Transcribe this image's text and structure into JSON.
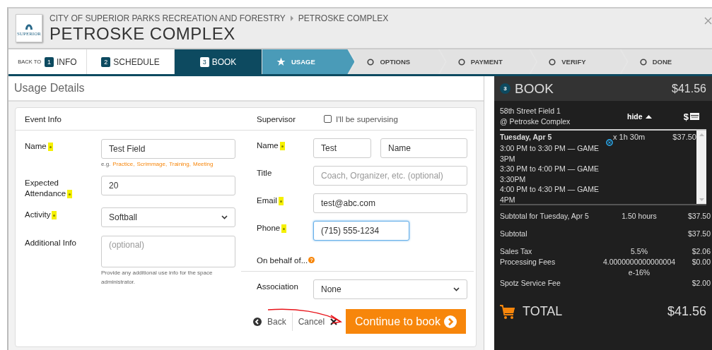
{
  "header": {
    "breadcrumb": [
      "CITY OF SUPERIOR PARKS RECREATION AND FORESTRY",
      "PETROSKE COMPLEX"
    ],
    "title": "PETROSKE COMPLEX",
    "logo_text": "SUPERIOR"
  },
  "steps": [
    {
      "kind": "back",
      "prefix": "BACK TO",
      "number": "1",
      "label": "INFO",
      "selected": false
    },
    {
      "kind": "numbered",
      "number": "2",
      "label": "SCHEDULE",
      "selected": false
    },
    {
      "kind": "numbered",
      "number": "3",
      "label": "BOOK",
      "selected": true
    }
  ],
  "substeps": [
    {
      "label": "USAGE",
      "selected": true
    },
    {
      "label": "OPTIONS",
      "selected": false
    },
    {
      "label": "PAYMENT",
      "selected": false
    },
    {
      "label": "VERIFY",
      "selected": false
    },
    {
      "label": "DONE",
      "selected": false
    }
  ],
  "section_title": "Usage Details",
  "event_info": {
    "heading": "Event Info",
    "fields": [
      {
        "kind": "text",
        "label": "Name",
        "required": true,
        "value": "Test Field",
        "examples_prefix": "e.g.",
        "examples": [
          "Practice,",
          "Scrimmage,",
          "Training,",
          "Meeting"
        ]
      },
      {
        "kind": "text",
        "label": "Expected Attendance",
        "required": true,
        "value": "20"
      },
      {
        "kind": "select",
        "label": "Activity",
        "required": true,
        "value": "Softball"
      },
      {
        "kind": "textarea",
        "label": "Additional Info",
        "required": false,
        "placeholder": "(optional)",
        "help": "Provide any additional use info for the space administrator."
      }
    ]
  },
  "supervisor": {
    "heading": "Supervisor",
    "self_checkbox": {
      "label": "I'll be supervising",
      "checked": false
    },
    "fields": [
      {
        "kind": "name",
        "label": "Name",
        "required": true,
        "first": "Test",
        "last": "Name"
      },
      {
        "kind": "text",
        "label": "Title",
        "required": false,
        "placeholder": "Coach, Organizer, etc. (optional)"
      },
      {
        "kind": "text",
        "label": "Email",
        "required": true,
        "value": "test@abc.com"
      },
      {
        "kind": "phone",
        "label": "Phone",
        "required": true,
        "value": "(715) 555-1234",
        "focused": true
      }
    ],
    "on_behalf": "On behalf of...",
    "help_icon": "?",
    "association": {
      "label": "Association",
      "value": "None"
    }
  },
  "actions": {
    "back": "Back",
    "cancel": "Cancel",
    "continue": "Continue to book"
  },
  "cart": {
    "number": "3",
    "title": "BOOK",
    "total_top": "$41.56",
    "venue": "58th Street Field 1",
    "location": "@ Petroske Complex",
    "toggle": "hide",
    "currency": "$",
    "date": "Tuesday, Apr 5",
    "duration": "x 1h 30m",
    "price": "$37.50",
    "slots": [
      "3:00 PM to 3:30 PM — GAME 3PM",
      "3:30 PM to 4:00 PM — GAME 3:30PM",
      "4:00 PM to 4:30 PM — GAME 4PM"
    ],
    "summary": [
      {
        "label": "Subtotal for Tuesday, Apr 5",
        "detail": "1.50 hours",
        "amount": "$37.50"
      },
      {
        "label": "Subtotal",
        "amount": "$37.50"
      },
      {
        "label": "Sales Tax",
        "detail": "5.5%",
        "amount": "$2.06"
      },
      {
        "label": "Processing Fees",
        "detail": "4.0000000000000004e-16%",
        "amount": "$0.00"
      },
      {
        "label": "Spotz Service Fee",
        "amount": "$2.00"
      }
    ],
    "total_label": "TOTAL",
    "total": "$41.56"
  }
}
